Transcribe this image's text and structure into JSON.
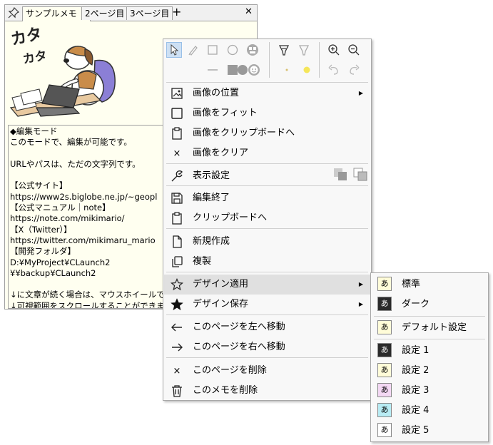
{
  "memo": {
    "tabs": [
      {
        "label": "サンプルメモ",
        "close": "×"
      },
      {
        "label": "2ページ目"
      },
      {
        "label": "3ページ目"
      }
    ],
    "add_tab": "+",
    "close": "✕",
    "image_text_1": "カタ",
    "image_text_2": "カタ",
    "lines": [
      "◆編集モード",
      "このモードで、編集が可能です。",
      "",
      "URLやパスは、ただの文字列です。",
      "",
      "【公式サイト】",
      "https://www2s.biglobe.ne.jp/~geopl",
      "【公式マニュアル｜note】",
      "https://note.com/mikimario/",
      "【X（Twitter）】",
      "https://twitter.com/mikimaru_mario",
      "【開発フォルダ】",
      "D:¥MyProject¥CLaunch2",
      "¥¥backup¥CLaunch2",
      "",
      "↓に文章が続く場合は、マウスホイールで",
      "↓可視範囲をスクロールすることができます。。"
    ]
  },
  "menu": {
    "items": [
      {
        "label": "画像の位置",
        "icon": "image-position-icon",
        "arrow": "▶"
      },
      {
        "label": "画像をフィット",
        "icon": "square-icon"
      },
      {
        "label": "画像をクリップボードへ",
        "icon": "clipboard-icon"
      },
      {
        "label": "画像をクリア",
        "icon": "x-icon",
        "glyph": "×"
      },
      {
        "label": "表示設定",
        "icon": "wrench-icon"
      },
      {
        "label": "編集終了",
        "icon": "save-icon"
      },
      {
        "label": "クリップボードへ",
        "icon": "clipboard-icon"
      },
      {
        "label": "新規作成",
        "icon": "new-page-icon"
      },
      {
        "label": "複製",
        "icon": "duplicate-icon"
      },
      {
        "label": "デザイン適用",
        "icon": "star-outline-icon",
        "arrow": "▶"
      },
      {
        "label": "デザイン保存",
        "icon": "star-filled-icon",
        "arrow": "▶"
      },
      {
        "label": "このページを左へ移動",
        "icon": "arrow-left-icon"
      },
      {
        "label": "このページを右へ移動",
        "icon": "arrow-right-icon"
      },
      {
        "label": "このページを削除",
        "icon": "x-icon",
        "glyph": "×"
      },
      {
        "label": "このメモを削除",
        "icon": "trash-icon"
      }
    ]
  },
  "submenu": {
    "items": [
      {
        "label": "標準",
        "swatch": "あ",
        "bg": "#fffcd8",
        "fg": "#000000"
      },
      {
        "label": "ダーク",
        "swatch": "あ",
        "bg": "#2a2a2a",
        "fg": "#ffffff"
      },
      {
        "label": "デフォルト設定",
        "swatch": "あ",
        "bg": "#fffcd8",
        "fg": "#000000"
      },
      {
        "label": "設定 1",
        "swatch": "あ",
        "bg": "#2a2a2a",
        "fg": "#ffffff"
      },
      {
        "label": "設定 2",
        "swatch": "あ",
        "bg": "#fffcd8",
        "fg": "#000000"
      },
      {
        "label": "設定 3",
        "swatch": "あ",
        "bg": "#f4d8f4",
        "fg": "#000000"
      },
      {
        "label": "設定 4",
        "swatch": "あ",
        "bg": "#b8ecf4",
        "fg": "#000000"
      },
      {
        "label": "設定 5",
        "swatch": "あ",
        "bg": "#ffffff",
        "fg": "#000000"
      }
    ]
  }
}
